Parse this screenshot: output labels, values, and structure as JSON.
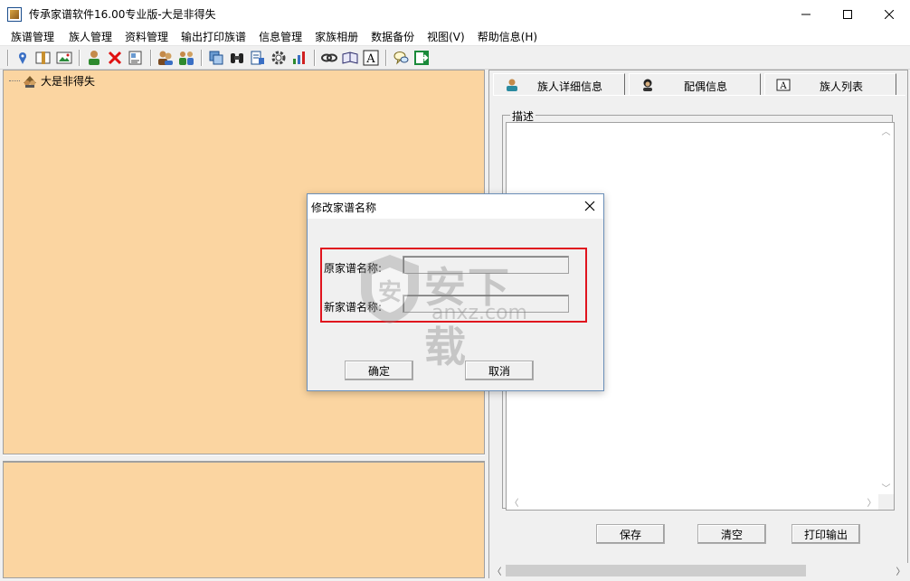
{
  "window": {
    "title": "传承家谱软件16.00专业版-大是非得失"
  },
  "menu": [
    "族谱管理",
    "族人管理",
    "资料管理",
    "输出打印族谱",
    "信息管理",
    "家族相册",
    "数据备份",
    "视图(V)",
    "帮助信息(H)"
  ],
  "tree": {
    "root_label": "大是非得失"
  },
  "tabs": [
    {
      "label": "族人详细信息"
    },
    {
      "label": "配偶信息"
    },
    {
      "label": "族人列表"
    }
  ],
  "detail": {
    "group_label": "描述",
    "save_label": "保存",
    "clear_label": "清空",
    "print_label": "打印输出"
  },
  "dialog": {
    "title": "修改家谱名称",
    "old_name_label": "原家谱名称:",
    "new_name_label": "新家谱名称:",
    "old_name_value": "",
    "new_name_value": "",
    "ok_label": "确定",
    "cancel_label": "取消"
  },
  "watermark": {
    "cn": "安下载",
    "en": "anxz.com"
  },
  "colors": {
    "tree_bg": "#fbd5a1",
    "highlight": "#e0141e"
  }
}
